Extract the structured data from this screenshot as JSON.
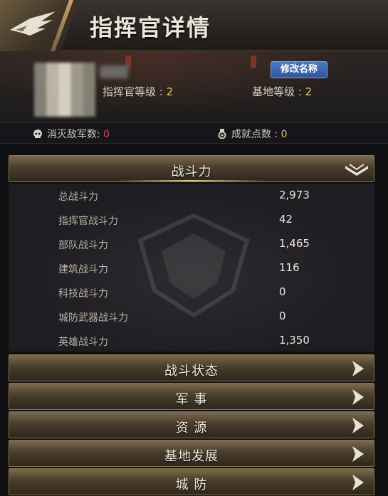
{
  "header": {
    "title": "指挥官详情"
  },
  "profile": {
    "rename_button": "修改名称",
    "commander_level_label": "指挥官等级 : ",
    "commander_level_value": "2",
    "base_level_label": "基地等级 : ",
    "base_level_value": "2"
  },
  "stats": {
    "kills_label": "消灭敌军数: ",
    "kills_value": "0",
    "achievement_label": "成就点数 : ",
    "achievement_value": "0"
  },
  "power_panel": {
    "title": "战斗力",
    "rows": [
      {
        "label": "总战斗力",
        "value": "2,973"
      },
      {
        "label": "指挥官战斗力",
        "value": "42"
      },
      {
        "label": "部队战斗力",
        "value": "1,465"
      },
      {
        "label": "建筑战斗力",
        "value": "116"
      },
      {
        "label": "科技战斗力",
        "value": "0"
      },
      {
        "label": "城防武器战斗力",
        "value": "0"
      },
      {
        "label": "英雄战斗力",
        "value": "1,350"
      }
    ]
  },
  "sections": [
    {
      "label": "战斗状态"
    },
    {
      "label": "军 事"
    },
    {
      "label": "资 源"
    },
    {
      "label": "基地发展"
    },
    {
      "label": "城 防"
    }
  ],
  "colors": {
    "accent_gold": "#e9c46a",
    "kills_red": "#e8483a",
    "rename_blue": "#3a66b3"
  }
}
